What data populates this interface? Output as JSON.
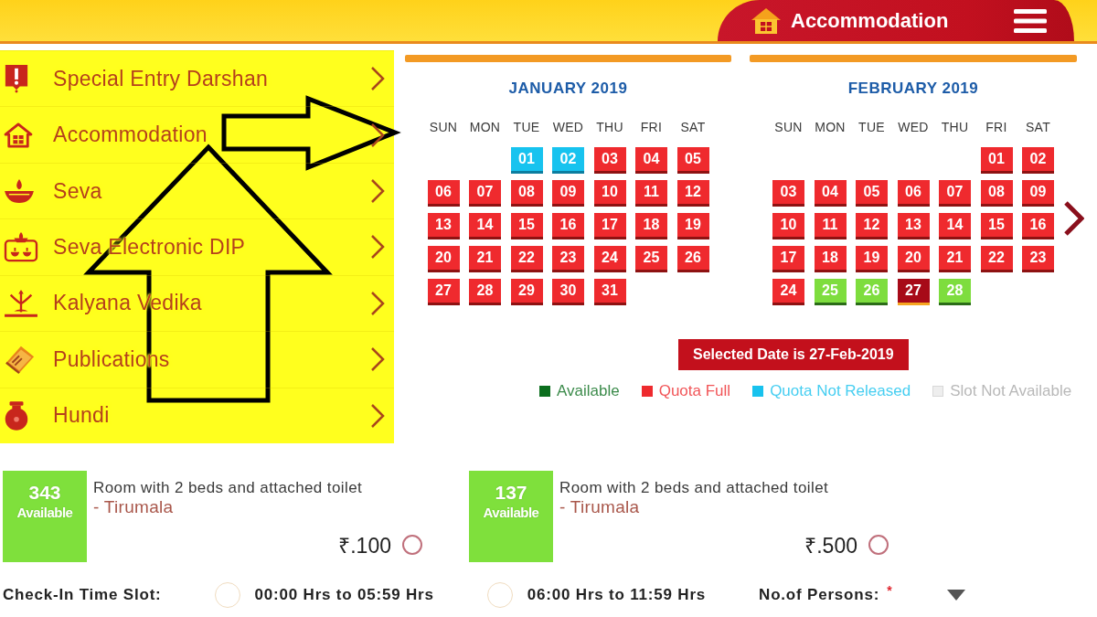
{
  "header": {
    "title": "Accommodation"
  },
  "sidebar": {
    "items": [
      {
        "label": "Special Entry Darshan"
      },
      {
        "label": "Accommodation"
      },
      {
        "label": "Seva"
      },
      {
        "label": "Seva Electronic DIP"
      },
      {
        "label": "Kalyana Vedika"
      },
      {
        "label": "Publications"
      },
      {
        "label": "Hundi"
      }
    ]
  },
  "calendar": {
    "months": [
      {
        "title": "JANUARY 2019",
        "weekdays": [
          "SUN",
          "MON",
          "TUE",
          "WED",
          "THU",
          "FRI",
          "SAT"
        ],
        "weeks": [
          [
            {
              "day": "01",
              "kind": "unreleased",
              "selected": false
            },
            {
              "day": "02",
              "kind": "unreleased",
              "selected": false
            },
            {
              "day": "03",
              "kind": "full",
              "selected": false
            },
            {
              "day": "04",
              "kind": "full",
              "selected": false
            },
            {
              "day": "05",
              "kind": "full",
              "selected": false
            }
          ],
          [
            {
              "day": "06",
              "kind": "full",
              "selected": false
            },
            {
              "day": "07",
              "kind": "full",
              "selected": false
            },
            {
              "day": "08",
              "kind": "full",
              "selected": false
            },
            {
              "day": "09",
              "kind": "full",
              "selected": false
            },
            {
              "day": "10",
              "kind": "full",
              "selected": false
            },
            {
              "day": "11",
              "kind": "full",
              "selected": false
            },
            {
              "day": "12",
              "kind": "full",
              "selected": false
            }
          ],
          [
            {
              "day": "13",
              "kind": "full",
              "selected": false
            },
            {
              "day": "14",
              "kind": "full",
              "selected": false
            },
            {
              "day": "15",
              "kind": "full",
              "selected": false
            },
            {
              "day": "16",
              "kind": "full",
              "selected": false
            },
            {
              "day": "17",
              "kind": "full",
              "selected": false
            },
            {
              "day": "18",
              "kind": "full",
              "selected": false
            },
            {
              "day": "19",
              "kind": "full",
              "selected": false
            }
          ],
          [
            {
              "day": "20",
              "kind": "full",
              "selected": false
            },
            {
              "day": "21",
              "kind": "full",
              "selected": false
            },
            {
              "day": "22",
              "kind": "full",
              "selected": false
            },
            {
              "day": "23",
              "kind": "full",
              "selected": false
            },
            {
              "day": "24",
              "kind": "full",
              "selected": false
            },
            {
              "day": "25",
              "kind": "full",
              "selected": false
            },
            {
              "day": "26",
              "kind": "full",
              "selected": false
            }
          ],
          [
            {
              "day": "27",
              "kind": "full",
              "selected": false
            },
            {
              "day": "28",
              "kind": "full",
              "selected": false
            },
            {
              "day": "29",
              "kind": "full",
              "selected": false
            },
            {
              "day": "30",
              "kind": "full",
              "selected": false
            },
            {
              "day": "31",
              "kind": "full",
              "selected": false
            }
          ]
        ]
      },
      {
        "title": "FEBRUARY 2019",
        "weekdays": [
          "SUN",
          "MON",
          "TUE",
          "WED",
          "THU",
          "FRI",
          "SAT"
        ],
        "weeks": [
          [
            {
              "day": "01",
              "kind": "full",
              "selected": false
            },
            {
              "day": "02",
              "kind": "full",
              "selected": false
            }
          ],
          [
            {
              "day": "03",
              "kind": "full",
              "selected": false
            },
            {
              "day": "04",
              "kind": "full",
              "selected": false
            },
            {
              "day": "05",
              "kind": "full",
              "selected": false
            },
            {
              "day": "06",
              "kind": "full",
              "selected": false
            },
            {
              "day": "07",
              "kind": "full",
              "selected": false
            },
            {
              "day": "08",
              "kind": "full",
              "selected": false
            },
            {
              "day": "09",
              "kind": "full",
              "selected": false
            }
          ],
          [
            {
              "day": "10",
              "kind": "full",
              "selected": false
            },
            {
              "day": "11",
              "kind": "full",
              "selected": false
            },
            {
              "day": "12",
              "kind": "full",
              "selected": false
            },
            {
              "day": "13",
              "kind": "full",
              "selected": false
            },
            {
              "day": "14",
              "kind": "full",
              "selected": false
            },
            {
              "day": "15",
              "kind": "full",
              "selected": false
            },
            {
              "day": "16",
              "kind": "full",
              "selected": false
            }
          ],
          [
            {
              "day": "17",
              "kind": "full",
              "selected": false
            },
            {
              "day": "18",
              "kind": "full",
              "selected": false
            },
            {
              "day": "19",
              "kind": "full",
              "selected": false
            },
            {
              "day": "20",
              "kind": "full",
              "selected": false
            },
            {
              "day": "21",
              "kind": "full",
              "selected": false
            },
            {
              "day": "22",
              "kind": "full",
              "selected": false
            },
            {
              "day": "23",
              "kind": "full",
              "selected": false
            }
          ],
          [
            {
              "day": "24",
              "kind": "full",
              "selected": false
            },
            {
              "day": "25",
              "kind": "available",
              "selected": false
            },
            {
              "day": "26",
              "kind": "available",
              "selected": false
            },
            {
              "day": "27",
              "kind": "available",
              "selected": true
            },
            {
              "day": "28",
              "kind": "available",
              "selected": false
            }
          ]
        ]
      }
    ],
    "selected_date": "Selected Date is 27-Feb-2019",
    "legend": [
      {
        "label": "Available",
        "color": "#0b6e1e"
      },
      {
        "label": "Quota Full",
        "color": "#ee2a2e"
      },
      {
        "label": "Quota Not Released",
        "color": "#18c2ee"
      },
      {
        "label": "Slot Not Available",
        "color": "#eeeeee"
      }
    ]
  },
  "rooms": [
    {
      "available_count": "343",
      "available_label": "Available",
      "description": "Room with 2 beds and attached toilet",
      "location": "- Tirumala",
      "price": "₹.100",
      "selected": false
    },
    {
      "available_count": "137",
      "available_label": "Available",
      "description": "Room with 2 beds and attached toilet",
      "location": "- Tirumala",
      "price": "₹.500",
      "selected": false
    }
  ],
  "check_in": {
    "label": "Check-In Time Slot:",
    "slots": [
      {
        "label": "00:00 Hrs to 05:59 Hrs",
        "selected": false
      },
      {
        "label": "06:00 Hrs to 11:59 Hrs",
        "selected": false
      }
    ]
  },
  "persons": {
    "label": "No.of Persons:",
    "required_mark": "*"
  }
}
